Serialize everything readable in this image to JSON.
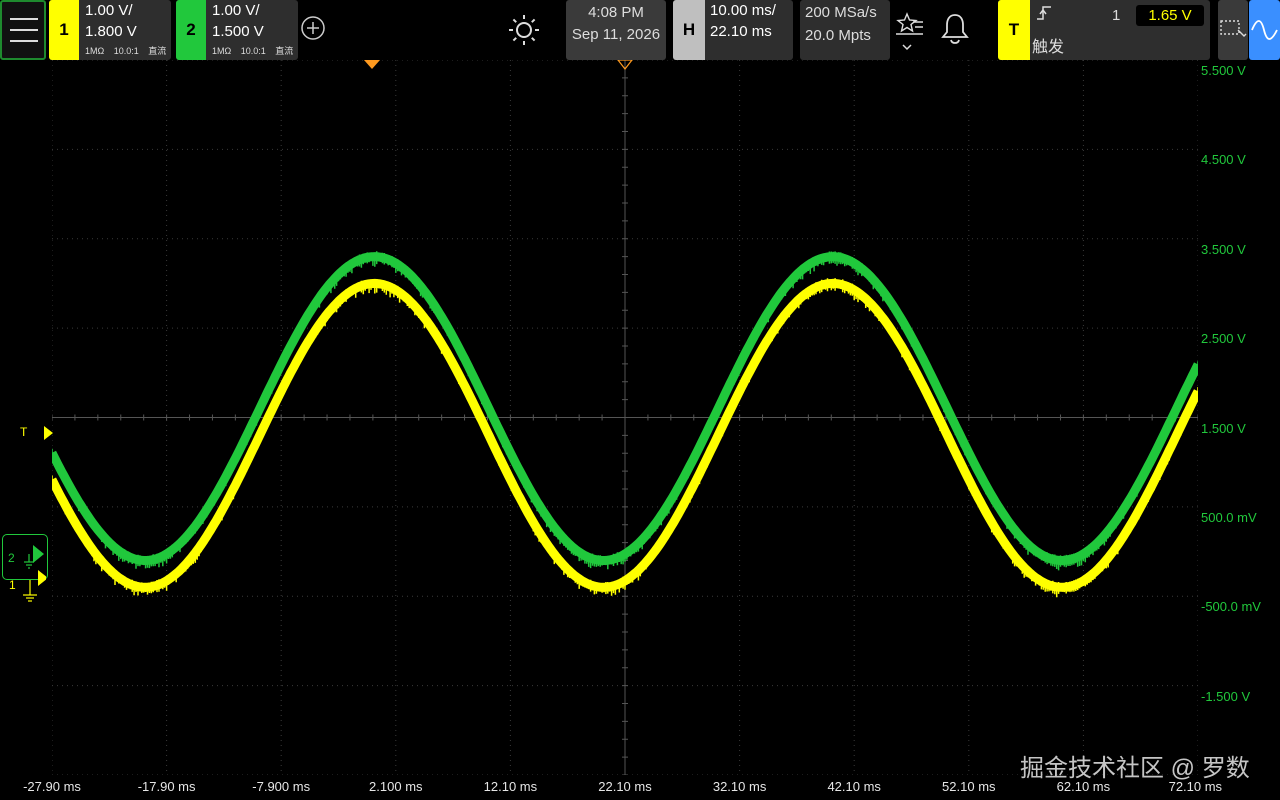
{
  "channel1": {
    "number": "1",
    "scale": "1.00 V/",
    "offset": "1.800 V",
    "impedance": "1MΩ",
    "probe": "10.0:1",
    "coupling": "直流",
    "color": "#ffff00"
  },
  "channel2": {
    "number": "2",
    "scale": "1.00 V/",
    "offset": "1.500 V",
    "impedance": "1MΩ",
    "probe": "10.0:1",
    "coupling": "直流",
    "color": "#21c83c"
  },
  "clock": {
    "time": "4:08 PM",
    "date": "Sep 11, 2026"
  },
  "horizontal": {
    "label": "H",
    "scale": "10.00 ms/",
    "delay": "22.10 ms"
  },
  "acquisition": {
    "sample_rate": "200 MSa/s",
    "memory_depth": "20.0 Mpts"
  },
  "trigger": {
    "label": "T",
    "source": "1",
    "level": "1.65 V",
    "mode": "触发",
    "edge_icon": "rising-edge-icon"
  },
  "icons": [
    "menu-icon",
    "add-channel-icon",
    "brightness-icon",
    "measure-icon",
    "bell-icon",
    "zoom-icon",
    "waveform-icon"
  ],
  "markers": {
    "trigger_marker": "T",
    "ch2_marker": "2",
    "ch1_marker": "1"
  },
  "y_axis_labels": [
    "5.500 V",
    "4.500 V",
    "3.500 V",
    "2.500 V",
    "1.500 V",
    "500.0 mV",
    "-500.0 mV",
    "-1.500 V"
  ],
  "x_axis_labels": [
    "-27.90 ms",
    "-17.90 ms",
    "-7.900 ms",
    "2.100 ms",
    "12.10 ms",
    "22.10 ms",
    "32.10 ms",
    "42.10 ms",
    "52.10 ms",
    "62.10 ms",
    "72.10 ms"
  ],
  "watermark": "掘金技术社区 @ 罗数",
  "chart_data": {
    "type": "line",
    "x_unit": "ms",
    "xlim": [
      -27.9,
      72.1
    ],
    "y_unit": "V",
    "ylim": [
      -2.5,
      5.5
    ],
    "series": [
      {
        "name": "1",
        "color": "#ffff00",
        "amplitude": 1.7,
        "offset": 1.3,
        "frequency_hz": 25,
        "phase_deg": 88
      },
      {
        "name": "2",
        "color": "#21c83c",
        "amplitude": 1.7,
        "offset": 1.6,
        "frequency_hz": 25,
        "phase_deg": 88
      }
    ]
  }
}
